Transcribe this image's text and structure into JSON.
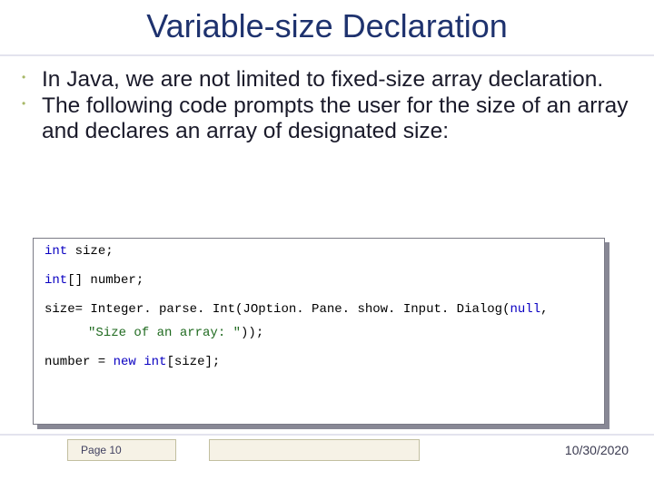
{
  "title": "Variable-size Declaration",
  "bullets": [
    "In Java, we are not limited to fixed-size array declaration.",
    "The following code prompts the user for the size of an array and declares an array of designated size:"
  ],
  "code": {
    "l1_kw": "int",
    "l1_rest": " size;",
    "l2_kw": "int",
    "l2_rest": "[] number;",
    "l3_a": "size= Integer. parse. Int(JOption. Pane. show. Input. Dialog(",
    "l3_null": "null",
    "l3_b": ",",
    "l4_str": "\"Size of an array: \"",
    "l4_rest": "));",
    "l5_a": "number = ",
    "l5_kw1": "new",
    "l5_b": " ",
    "l5_kw2": "int",
    "l5_c": "[size];"
  },
  "footer": {
    "page_prefix": "Pa",
    "page_g": "g",
    "page_rest": "e 10",
    "date": "10/30/2020"
  }
}
